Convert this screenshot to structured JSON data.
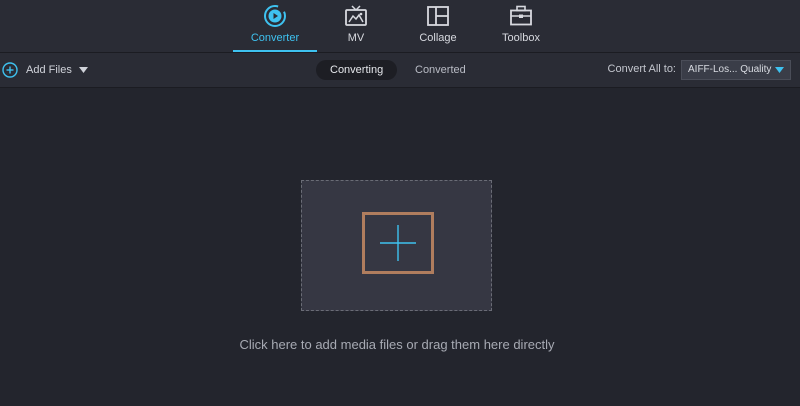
{
  "nav": {
    "tabs": [
      {
        "label": "Converter",
        "icon": "converter-icon",
        "active": true
      },
      {
        "label": "MV",
        "icon": "tv-icon",
        "active": false
      },
      {
        "label": "Collage",
        "icon": "collage-icon",
        "active": false
      },
      {
        "label": "Toolbox",
        "icon": "toolbox-icon",
        "active": false
      }
    ]
  },
  "toolbar": {
    "add_files_label": "Add Files",
    "segments": [
      "Converting",
      "Converted"
    ],
    "active_segment": "Converting",
    "convert_all_label": "Convert All to:",
    "format_value": "AIFF-Los... Quality"
  },
  "main": {
    "hint": "Click here to add media files or drag them here directly"
  },
  "colors": {
    "accent": "#3ec2f0",
    "background": "#23252d",
    "add_box_border": "#b07d5e"
  }
}
